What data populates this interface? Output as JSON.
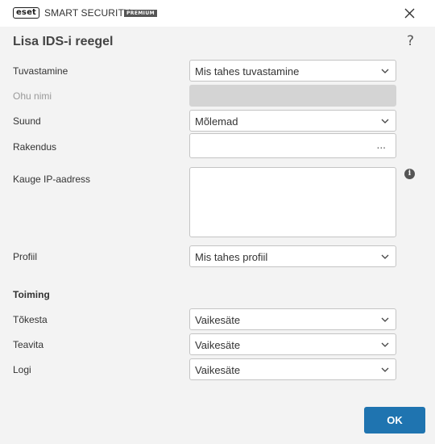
{
  "window": {
    "brand_logo": "eset",
    "product_name": "SMART SECURITY",
    "edition_badge": "PREMIUM",
    "close_icon": "close-icon"
  },
  "dialog": {
    "title": "Lisa IDS-i reegel",
    "help_label": "?"
  },
  "form": {
    "detection": {
      "label": "Tuvastamine",
      "value": "Mis tahes tuvastamine"
    },
    "threat_name": {
      "label": "Ohu nimi",
      "value": ""
    },
    "direction": {
      "label": "Suund",
      "value": "Mõlemad"
    },
    "application": {
      "label": "Rakendus",
      "value": "",
      "browse_label": "..."
    },
    "remote_ip": {
      "label": "Kauge IP-aadress",
      "value": "",
      "info_label": "i"
    },
    "profile": {
      "label": "Profiil",
      "value": "Mis tahes profiil"
    }
  },
  "action": {
    "section_title": "Toiming",
    "block": {
      "label": "Tõkesta",
      "value": "Vaikesäte"
    },
    "notify": {
      "label": "Teavita",
      "value": "Vaikesäte"
    },
    "log": {
      "label": "Logi",
      "value": "Vaikesäte"
    }
  },
  "footer": {
    "ok_label": "OK"
  },
  "colors": {
    "accent": "#1f74b0",
    "background": "#f3f3f3",
    "disabled_field": "#d4d4d4"
  }
}
